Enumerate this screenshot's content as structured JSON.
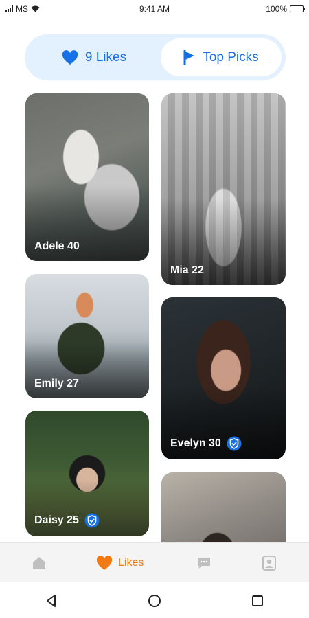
{
  "status_bar": {
    "carrier": "MS",
    "time": "9:41 AM",
    "battery": "100%",
    "battery_level": 1.0
  },
  "tabs": [
    {
      "label": "9 Likes",
      "icon": "heart-icon",
      "selected": false
    },
    {
      "label": "Top Picks",
      "icon": "flag-icon",
      "selected": true
    }
  ],
  "profiles": [
    {
      "name_age": "Adele 40",
      "verified": false
    },
    {
      "name_age": "Mia 22",
      "verified": false
    },
    {
      "name_age": "Emily 27",
      "verified": false
    },
    {
      "name_age": "Evelyn 30",
      "verified": true
    },
    {
      "name_age": "Daisy 25",
      "verified": true
    },
    {
      "name_age": "",
      "verified": false
    }
  ],
  "bottom_nav": {
    "items": [
      {
        "icon": "home-icon",
        "label": ""
      },
      {
        "icon": "heart-icon",
        "label": "Likes",
        "active": true
      },
      {
        "icon": "chat-icon",
        "label": ""
      },
      {
        "icon": "profile-icon",
        "label": ""
      }
    ]
  },
  "colors": {
    "accent_blue": "#1670e6",
    "tab_background": "#e3f0fd",
    "active_orange": "#f07a16",
    "inactive_icon": "#bfbfbf"
  }
}
